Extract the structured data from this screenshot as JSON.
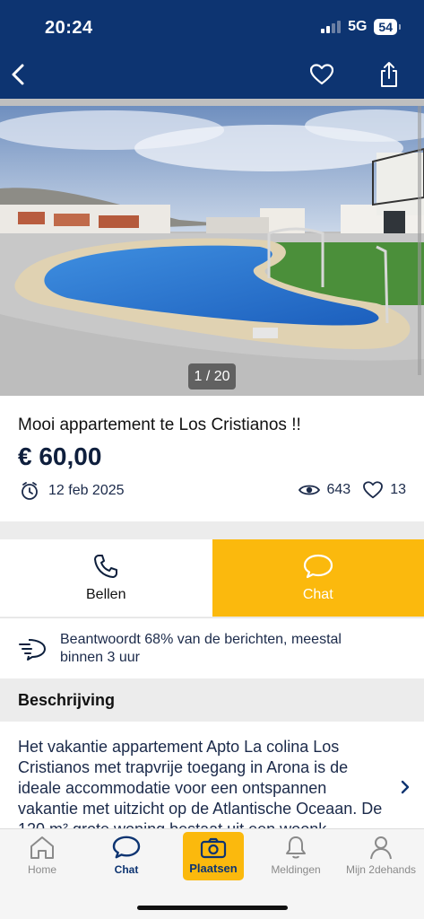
{
  "status_bar": {
    "time": "20:24",
    "network": "5G",
    "battery": "54"
  },
  "header": {
    "back_icon": "chevron-left-icon",
    "favorite_icon": "heart-outline-icon",
    "share_icon": "share-icon"
  },
  "listing": {
    "photo_counter": "1 / 20",
    "title": "Mooi appartement te Los Cristianos !!",
    "price": "€ 60,00",
    "date": "12 feb 2025",
    "views": "643",
    "favorites": "13"
  },
  "actions": {
    "call_label": "Bellen",
    "chat_label": "Chat"
  },
  "reply_info": {
    "text": "Beantwoordt  68% van de berichten, meestal binnen  3 uur"
  },
  "description": {
    "heading": "Beschrijving",
    "text": "Het vakantie appartement Apto La colina Los Cristianos met trapvrije toegang in Arona is de ideale accommodatie voor een ontspannen vakantie met uitzicht op de Atlantische Oceaan. De 120 m² grote woning bestaat uit een woonk"
  },
  "tabbar": {
    "home": "Home",
    "chat": "Chat",
    "place": "Plaatsen",
    "notifications": "Meldingen",
    "profile": "Mijn 2dehands"
  },
  "colors": {
    "brand_navy": "#0d3471",
    "accent_yellow": "#fbb90d"
  }
}
